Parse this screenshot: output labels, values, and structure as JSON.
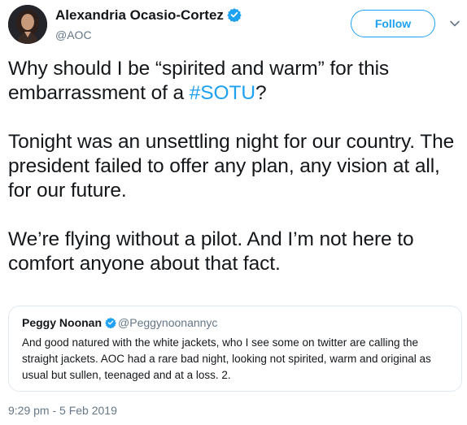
{
  "author": {
    "display_name": "Alexandria Ocasio-Cortez",
    "handle": "@AOC",
    "verified": true,
    "avatar": "avatar-photo-icon"
  },
  "follow_label": "Follow",
  "tweet": {
    "line1_before": "Why should I be “spirited and warm” for this embarrassment of a ",
    "hashtag": "#SOTU",
    "line1_after": "?",
    "paragraph2": "Tonight was an unsettling night for our country. The president failed to offer any plan, any vision at all, for our future.",
    "paragraph3": "We’re flying without a pilot. And I’m not here to comfort anyone about that fact."
  },
  "quoted_tweet": {
    "display_name": "Peggy Noonan",
    "handle": "@Peggynoonannyc",
    "verified": true,
    "text": "And good natured with the white jackets, who I see some on twitter are calling the straight jackets. AOC had a rare bad night, looking not spirited, warm and original as usual but sullen, teenaged and at a loss. 2."
  },
  "timestamp": "9:29 pm - 5 Feb 2019",
  "colors": {
    "accent": "#1da1f2",
    "text": "#14171a",
    "secondary_text": "#657786",
    "border": "#e1e8ed"
  }
}
